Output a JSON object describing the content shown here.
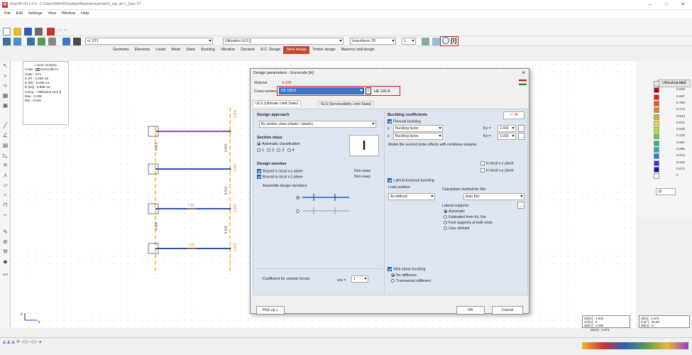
{
  "window": {
    "title": "AxisVM (X) 1.0.0 - C:\\Users\\MAXR\\Desktop\\Munkak\\mykmidt\\1j_opt_alt-1_Zaxs ST"
  },
  "menu": [
    "File",
    "Edit",
    "Settings",
    "View",
    "Window",
    "Help"
  ],
  "module_tabs": [
    "Geometry",
    "Elements",
    "Loads",
    "Mesh",
    "Static",
    "Buckling",
    "Vibration",
    "Dynamic",
    "R.C. Design",
    "Steel design",
    "Timber design",
    "Masonry wall design"
  ],
  "active_tab": "Steel design",
  "toolbar2": {
    "section_combo": "ʌi: ST1",
    "result_combo": "Utilization ULS []",
    "display_combo": "Isosurfaces 2D",
    "step_value": "1"
  },
  "info": {
    "title": "Linear analysis",
    "rows": [
      {
        "k": "Code",
        "v": "Eurocode-H"
      },
      {
        "k": "Case",
        "v": "ST1"
      },
      {
        "k": "E (P)",
        "v": "2.00E-13"
      },
      {
        "k": "E (W)",
        "v": "2.00E-13"
      },
      {
        "k": "E (Eq)",
        "v": "8.88E-16"
      },
      {
        "k": "Comp.",
        "v": "Utilization ULS []"
      },
      {
        "k": "Max",
        "v": "0.296"
      },
      {
        "k": "Min",
        "v": "0.020"
      }
    ]
  },
  "canvas_labels": {
    "v1": "4.000",
    "v2": "3.925",
    "v3": "4.000",
    "v4": "4.000",
    "v5": "8.025",
    "v6": "4.000",
    "v7": "8.600",
    "s1": "3.925",
    "s2": "2 [1]",
    "s3": "4.000",
    "s4": "3 [1]"
  },
  "scale": {
    "header": "Utilization ULS",
    "values": [
      "1.000",
      "0.929",
      "0.857",
      "0.786",
      "0.714",
      "0.643",
      "0.571",
      "0.500",
      "0.429",
      "0.357",
      "0.286",
      "0.214",
      "0.143",
      "0.071",
      "0"
    ],
    "colors": [
      "#e8e8e8",
      "#c00000",
      "#e02020",
      "#f05010",
      "#f08010",
      "#f0b000",
      "#e8e020",
      "#b8e020",
      "#60d030",
      "#20c080",
      "#20b0d0",
      "#2080e0",
      "#2040e0",
      "#1010a0",
      "#ffffff"
    ],
    "count_value": "15"
  },
  "coords": {
    "box1": [
      "dX[m] : 1.522",
      "dY[m] : 0",
      "dZ[m] : 1.088",
      "dL[m] : 1.871"
    ],
    "box2": [
      "dr[m] : 1.871",
      "d a[°] : 35.56",
      "dh[m] : 0"
    ]
  },
  "dialog": {
    "title": "Design parameters - Eurocode [H]",
    "material_label": "Material",
    "material_value": "S 235",
    "cross_section_label": "Cross-section",
    "cross_section_value": "HE 180 A",
    "cross_section_alt": "HE 180 A",
    "tabs": [
      "ULS (Ultimate Limit State)",
      "SLS (Serviceability Limit State)"
    ],
    "design_approach_title": "Design approach",
    "design_approach_value": "By section class (elastic / plastic)",
    "section_class_title": "Section class",
    "section_class_auto": "Automatic classification",
    "section_class_options": [
      "1",
      "2",
      "3",
      "4"
    ],
    "design_member_title": "Design member",
    "braced_y": "Braced in local x-y plane",
    "braced_z": "Braced in local x-z plane",
    "nonsway1": "Non-sway",
    "nonsway2": "Non-sway",
    "assemble_label": "Assemble design members",
    "seismic_label": "Coefficient for seismic forces",
    "seismic_symbol": "γov =",
    "seismic_value": "1",
    "buckling_title": "Buckling coefficients",
    "flexural": "Flexural buckling",
    "buckling_factor": "Buckling factor",
    "ky_label": "Ky =",
    "ky_value": "1.000",
    "kz_label": "Kz =",
    "kz_value": "1.000",
    "row_y": "y",
    "row_z": "z",
    "model_second": "Model the second order effects with nonlinear analysis",
    "in_local_xz": "in local x-z plane",
    "in_local_xy": "in local x-y plane",
    "lateral_torsional": "Lateral-torsional buckling",
    "load_position_label": "Load position",
    "load_position_value": "As defined",
    "calc_method_label": "Calculation method for Mcr",
    "calc_method_value": "Auto Mcr",
    "lateral_supports_label": "Lateral supports",
    "lateral_options": [
      "Automatic",
      "Estimated from Kz, Kw",
      "Fork supports at both ends",
      "User defined"
    ],
    "web_shear": "Web shear buckling",
    "web_options": [
      "No stiffeners",
      "Transversal stiffeners"
    ],
    "pickup_label": "Pick up »",
    "ok_label": "OK",
    "cancel_label": "Cancel",
    "copy_label": "≫"
  }
}
